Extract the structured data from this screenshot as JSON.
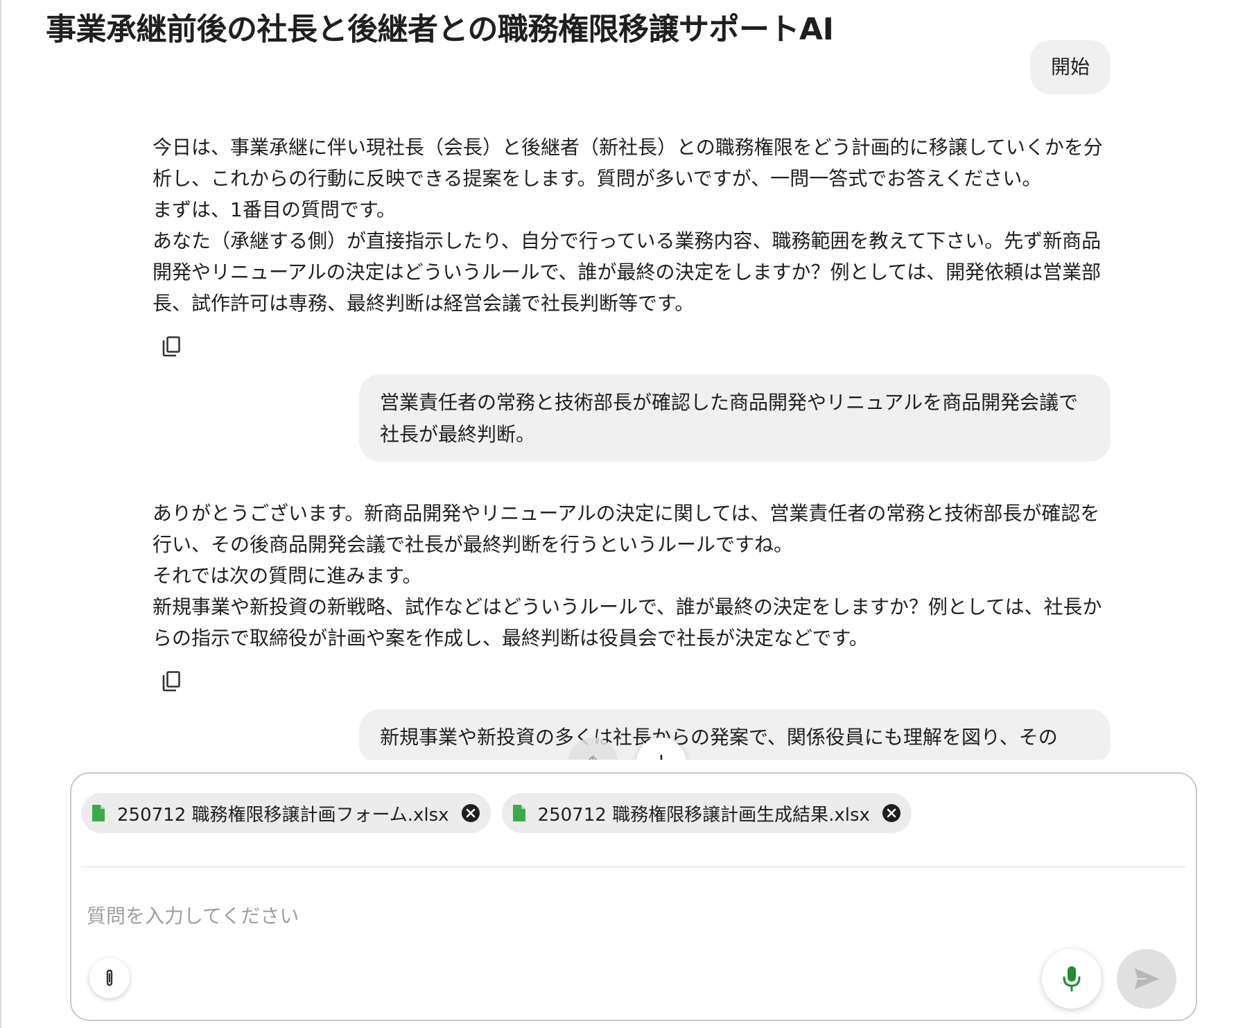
{
  "app": {
    "title": "事業承継前後の社長と後継者との職務権限移譲サポートAI"
  },
  "messages": [
    {
      "role": "user",
      "text": "開始"
    },
    {
      "role": "assistant",
      "lines": [
        "今日は、事業承継に伴い現社長（会長）と後継者（新社長）との職務権限をどう計画的に移譲していくかを分析し、これからの行動に反映できる提案をします。質問が多いですが、一問一答式でお答えください。",
        "まずは、1番目の質問です。",
        "あなた（承継する側）が直接指示したり、自分で行っている業務内容、職務範囲を教えて下さい。先ず新商品開発やリニューアルの決定はどういうルールで、誰が最終の決定をしますか？例としては、開発依頼は営業部長、試作許可は専務、最終判断は経営会議で社長判断等です。"
      ]
    },
    {
      "role": "user",
      "text": "営業責任者の常務と技術部長が確認した商品開発やリニュアルを商品開発会議で社長が最終判断。"
    },
    {
      "role": "assistant",
      "lines": [
        "ありがとうございます。新商品開発やリニューアルの決定に関しては、営業責任者の常務と技術部長が確認を行い、その後商品開発会議で社長が最終判断を行うというルールですね。",
        "それでは次の質問に進みます。",
        "新規事業や新投資の新戦略、試作などはどういうルールで、誰が最終の決定をしますか？例としては、社長からの指示で取締役が計画や案を作成し、最終判断は役員会で社長が決定などです。"
      ]
    },
    {
      "role": "user",
      "text": "新規事業や新投資の多くは社長からの発案で、関係役員にも理解を図り、その"
    }
  ],
  "composer": {
    "attachments": [
      {
        "name": "250712 職務権限移譲計画フォーム.xlsx"
      },
      {
        "name": "250712 職務権限移譲計画生成結果.xlsx"
      }
    ],
    "input_value": "",
    "placeholder": "質問を入力してください"
  },
  "icons": {
    "copy": "copy-icon",
    "scroll_up": "arrow-up-icon",
    "scroll_down": "arrow-down-icon",
    "file": "spreadsheet-file-icon",
    "remove": "close-circle-icon",
    "attach": "paperclip-icon",
    "mic": "microphone-icon",
    "send": "send-icon"
  },
  "colors": {
    "user_bubble": "#f0f0f0",
    "file_icon": "#3aaa4a",
    "mic": "#1e8e2e",
    "send_disabled_bg": "#e0e0e0",
    "send_icon": "#b8b8b8"
  }
}
